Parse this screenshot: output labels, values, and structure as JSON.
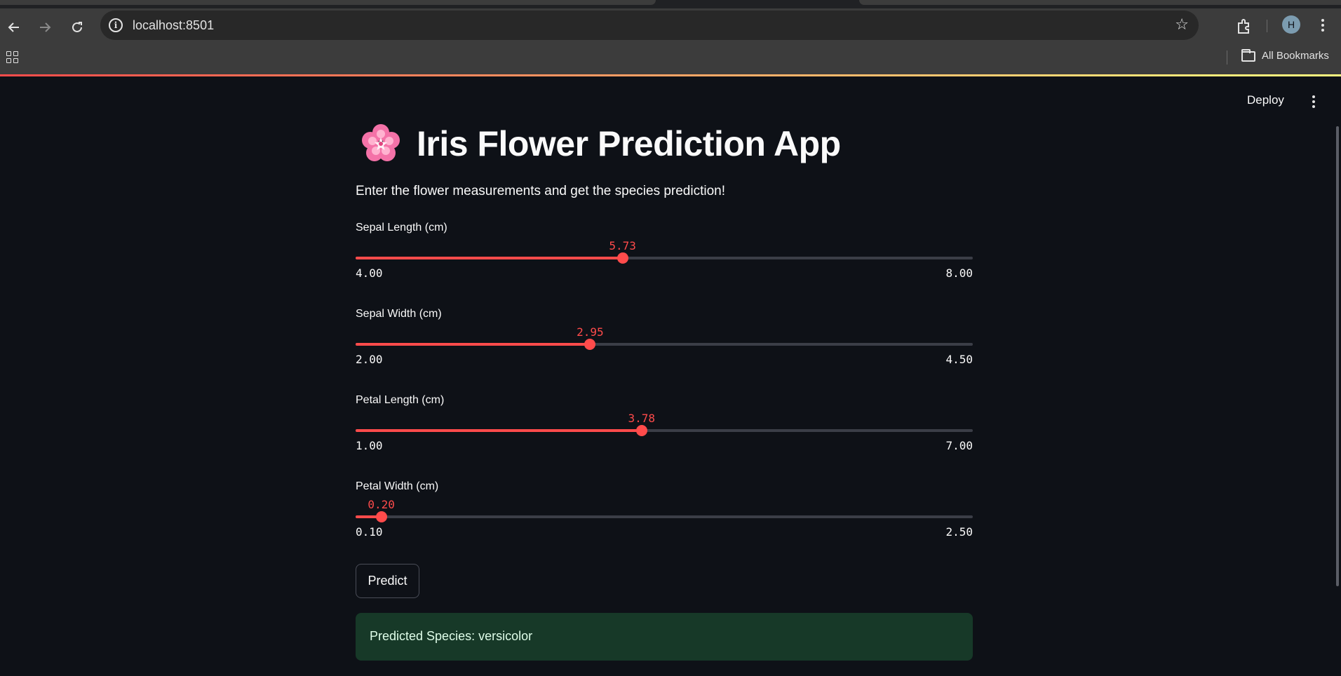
{
  "browser": {
    "url": "localhost:8501",
    "profile_initial": "H",
    "bookmarks_label": "All Bookmarks",
    "icons": [
      "back-arrow-icon",
      "forward-arrow-icon",
      "reload-icon",
      "site-info-icon",
      "bookmark-star-icon",
      "extensions-icon",
      "profile-avatar",
      "menu-kebab-icon",
      "apps-grid-icon",
      "folder-icon"
    ]
  },
  "app": {
    "deploy_label": "Deploy",
    "title_emoji": "cherry-blossom-icon",
    "title": "Iris Flower Prediction App",
    "subtitle": "Enter the flower measurements and get the species prediction!",
    "accent_color": "#ff4b4b",
    "sliders": [
      {
        "label": "Sepal Length (cm)",
        "value": 5.73,
        "value_text": "5.73",
        "min": 4.0,
        "min_text": "4.00",
        "max": 8.0,
        "max_text": "8.00"
      },
      {
        "label": "Sepal Width (cm)",
        "value": 2.95,
        "value_text": "2.95",
        "min": 2.0,
        "min_text": "2.00",
        "max": 4.5,
        "max_text": "4.50"
      },
      {
        "label": "Petal Length (cm)",
        "value": 3.78,
        "value_text": "3.78",
        "min": 1.0,
        "min_text": "1.00",
        "max": 7.0,
        "max_text": "7.00"
      },
      {
        "label": "Petal Width (cm)",
        "value": 0.2,
        "value_text": "0.20",
        "min": 0.1,
        "min_text": "0.10",
        "max": 2.5,
        "max_text": "2.50"
      }
    ],
    "predict_label": "Predict",
    "result_text": "Predicted Species: versicolor",
    "result_color": "#173928"
  }
}
